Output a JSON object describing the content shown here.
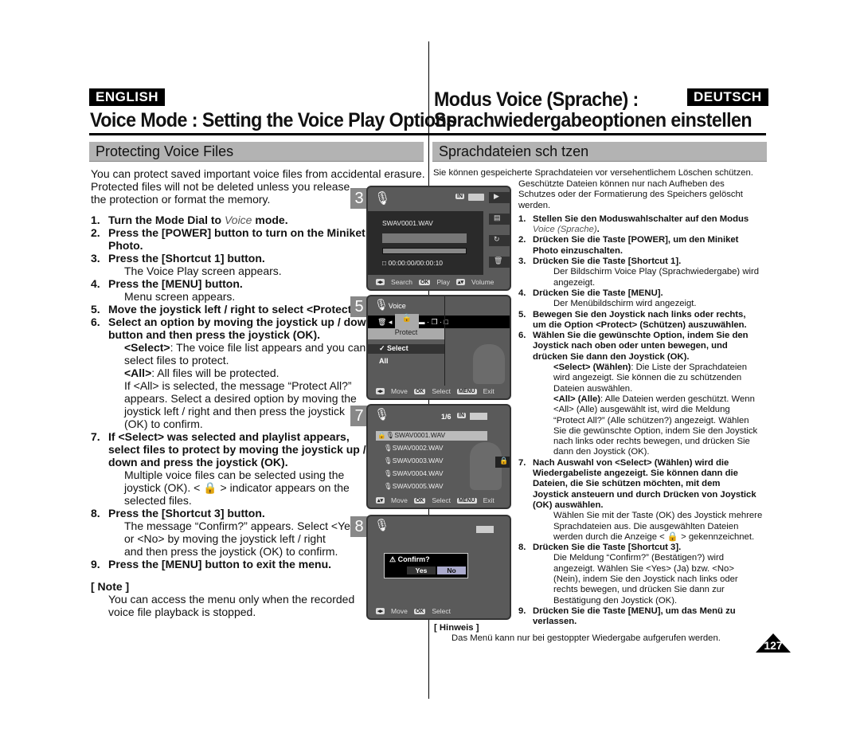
{
  "en": {
    "lang": "ENGLISH",
    "title": "Voice Mode : Setting the Voice Play Options",
    "section": "Protecting Voice Files",
    "intro1": "You can protect saved important voice files from accidental erasure.",
    "intro2": "Protected files will not be deleted unless you release",
    "intro3": "the protection or format the memory.",
    "s1a": "Turn the Mode Dial to ",
    "s1b": "Voice",
    "s1c": " mode.",
    "s2a": "Press the [POWER] button to turn on the Miniket",
    "s2b": "Photo.",
    "s3": "Press the [Shortcut 1] button.",
    "s3d": "The Voice Play screen appears.",
    "s4": "Press the [MENU] button.",
    "s4d": "Menu screen appears.",
    "s5": "Move the joystick left / right to select <Protect>.",
    "s6a": "Select an option by moving the joystick up / down",
    "s6b": "button and then press the joystick (OK).",
    "s6sel_b": "<Select>",
    "s6sel": ": The voice file list appears and you can",
    "s6sel2": "select files to protect.",
    "s6all_b": "<All>",
    "s6all": ": All files will be protected.",
    "s6m1": "If <All> is selected, the message “Protect All?”",
    "s6m2": "appears. Select a desired option by moving the",
    "s6m3": "joystick left / right and then press the joystick",
    "s6m4": "(OK) to confirm.",
    "s7a": "If <Select> was selected and playlist appears,",
    "s7b": "select files to protect by moving the joystick up /",
    "s7c": "down and press the joystick (OK).",
    "s7d1": "Multiple voice files can be selected using the",
    "s7d2a": "joystick (OK). < ",
    "s7d2b": " > indicator appears on the",
    "s7d3": "selected files.",
    "s8": "Press the [Shortcut 3] button.",
    "s8d1": "The message “Confirm?” appears. Select <Yes>",
    "s8d2": "or <No> by moving the joystick left / right",
    "s8d3": "and then press the joystick (OK) to confirm.",
    "s9": "Press the [MENU] button to exit the menu.",
    "note_h": "[ Note ]",
    "note1": "You can access the menu only when the recorded",
    "note2": "voice file playback is stopped."
  },
  "de": {
    "lang": "DEUTSCH",
    "title1": "Modus Voice (Sprache) :",
    "title2": "Sprachwiedergabeoptionen einstellen",
    "section": "Sprachdateien sch tzen",
    "intro1": "Sie können gespeicherte Sprachdateien vor versehentlichem Löschen schützen.",
    "intro2": "Geschützte Dateien können nur nach Aufheben des",
    "intro3": "Schutzes oder der Formatierung des Speichers gelöscht",
    "intro4": "werden.",
    "s1a": "Stellen Sie den Moduswahlschalter auf den Modus",
    "s1b": "Voice (Sprache)",
    "s1c": ".",
    "s2a": "Drücken Sie die Taste [POWER], um den Miniket",
    "s2b": "Photo einzuschalten.",
    "s3": "Drücken Sie die Taste [Shortcut 1].",
    "s3d1": "Der Bildschirm Voice Play (Sprachwiedergabe) wird",
    "s3d2": "angezeigt.",
    "s4": "Drücken Sie die Taste [MENU].",
    "s4d": "Der Menübildschirm wird angezeigt.",
    "s5a": "Bewegen Sie den Joystick nach links oder rechts,",
    "s5b": "um die Option <Protect> (Schützen) auszuwählen.",
    "s6a": "Wählen Sie die gewünschte Option, indem Sie den",
    "s6b": "Joystick nach oben oder unten bewegen, und",
    "s6c": "drücken Sie dann den Joystick (OK).",
    "s6sel_b": "<Select> (Wählen)",
    "s6sel1": ": Die Liste der Sprachdateien",
    "s6sel2": "wird angezeigt. Sie können die zu schützenden",
    "s6sel3": "Dateien auswählen.",
    "s6all_b": "<All> (Alle)",
    "s6all1": ": Alle Dateien werden geschützt. Wenn",
    "s6all2": "<All> (Alle) ausgewählt ist, wird die Meldung",
    "s6all3": "“Protect All?” (Alle schützen?) angezeigt. Wählen",
    "s6all4": "Sie die gewünschte Option, indem Sie den Joystick",
    "s6all5": "nach links oder rechts bewegen, und drücken Sie",
    "s6all6": "dann den Joystick (OK).",
    "s7a": "Nach Auswahl von <Select> (Wählen) wird die",
    "s7b": "Wiedergabeliste angezeigt. Sie können dann die",
    "s7c": "Dateien, die Sie schützen möchten, mit dem",
    "s7d": "Joystick ansteuern und durch Drücken von Joystick",
    "s7e": "(OK) auswählen.",
    "s7f1": "Wählen Sie mit der Taste (OK) des Joystick mehrere",
    "s7f2": "Sprachdateien aus. Die ausgewählten Dateien",
    "s7f3a": "werden durch die Anzeige < ",
    "s7f3b": " > gekennzeichnet.",
    "s8": "Drücken Sie die Taste [Shortcut 3].",
    "s8d1": "Die Meldung “Confirm?” (Bestätigen?) wird",
    "s8d2": "angezeigt. Wählen Sie <Yes> (Ja) bzw. <No>",
    "s8d3": "(Nein), indem Sie den Joystick nach links oder",
    "s8d4": "rechts bewegen, und drücken Sie dann zur",
    "s8d5": "Bestätigung den Joystick (OK).",
    "s9a": "Drücken Sie die Taste [MENU], um das Menü zu",
    "s9b": "verlassen.",
    "note_h": "[ Hinweis ]",
    "note": "Das Menü kann nur bei gestoppter Wiedergabe aufgerufen werden."
  },
  "screens": {
    "s3": {
      "step": "3",
      "file": "SWAV0001.WAV",
      "time": "00:00:00/00:00:10",
      "mem": "IN",
      "foot": [
        "Search",
        "Play",
        "Volume"
      ],
      "keys": [
        "◂▸",
        "OK",
        "▴▾"
      ]
    },
    "s5": {
      "step": "5",
      "mode": "Voice",
      "menu_item": "Protect",
      "options": [
        "Select",
        "All"
      ],
      "selected": "Select",
      "foot": [
        "Move",
        "Select",
        "Exit"
      ],
      "keys": [
        "◂▸",
        "OK",
        "MENU"
      ]
    },
    "s7": {
      "step": "7",
      "counter": "1/6",
      "mem": "IN",
      "files": [
        "SWAV0001.WAV",
        "SWAV0002.WAV",
        "SWAV0003.WAV",
        "SWAV0004.WAV",
        "SWAV0005.WAV"
      ],
      "foot": [
        "Move",
        "Select",
        "Exit"
      ],
      "keys": [
        "▴▾",
        "OK",
        "MENU"
      ]
    },
    "s8": {
      "step": "8",
      "dialog": "Confirm?",
      "yes": "Yes",
      "no": "No",
      "foot": [
        "Move",
        "Select"
      ],
      "keys": [
        "◂▸",
        "OK"
      ]
    }
  },
  "page_number": "127"
}
